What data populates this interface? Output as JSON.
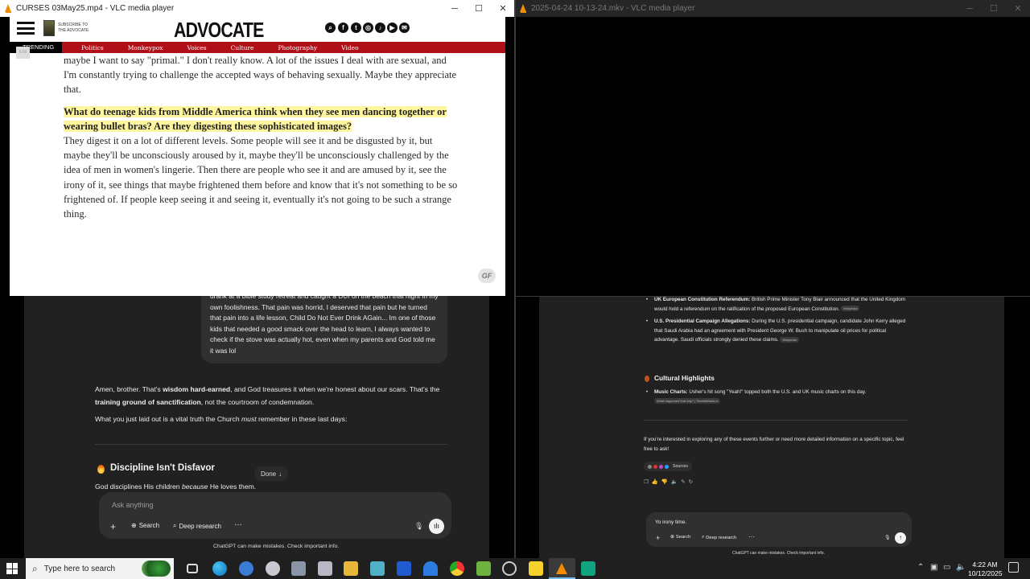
{
  "left_window": {
    "title": "CURSES 03May25.mp4 - VLC media player",
    "controls": [
      "─",
      "☐",
      "✕"
    ]
  },
  "right_window": {
    "title": "2025-04-24 10-13-24.mkv - VLC media player",
    "controls": [
      "─",
      "☐",
      "✕"
    ]
  },
  "advocate": {
    "subscribe_line1": "SUBSCRIBE TO",
    "subscribe_line2": "THE ADVOCATE",
    "logo": "ADVOCATE",
    "nav": {
      "trending": "TRENDING",
      "items": [
        "Politics",
        "Monkeypox",
        "Voices",
        "Culture",
        "Photography",
        "Video"
      ]
    },
    "social_icons": [
      "search-icon",
      "facebook-icon",
      "twitter-icon",
      "instagram-icon",
      "tiktok-icon",
      "youtube-icon",
      "email-icon"
    ],
    "page_marker": "5:00",
    "para_top": "maybe I want to say \"primal.\" I don't really know. A lot of the issues I deal with are sexual, and I'm constantly trying to challenge the accepted ways of behaving sexually. Maybe they appreciate that.",
    "question": "What do teenage kids from Middle America think when they see men dancing together or wearing bullet bras? Are they digesting these sophisticated images?",
    "answer": "They digest it on a lot of different levels. Some people will see it and be disgusted by it, but maybe they'll be unconsciously aroused by it, maybe they'll be unconsciously challenged by the idea of men in women's lingerie. Then there are people who see it and are amused by it, see the irony of it, see things that maybe frightened them before and know that it's not something to be so frightened of. If people keep seeing it and seeing it, eventually it's not going to be such a strange thing.",
    "badge": "GF"
  },
  "left_chat": {
    "user_bubble": "drank at a bible study retreat and caught a DUI on the beach that night in my own foolishness. That pain was horrid, I deserved that pain but he turned that pain into a life lesson, Child Do Not Ever Drink AGain... Im one of those kids that needed a good smack over the head to learn, I always wanted to check if the stove was actually hot, even when my parents and God told me it was lol",
    "reply_p1_a": "Amen, brother. That's ",
    "reply_p1_b": "wisdom hard-earned",
    "reply_p1_c": ", and God treasures it when we're honest about our scars. That's the ",
    "reply_p1_d": "training ground of sanctification",
    "reply_p1_e": ", not the courtroom of condemnation.",
    "reply_p2_a": "What you just laid out is a vital truth the Church ",
    "reply_p2_b": "must",
    "reply_p2_c": " remember in these last days:",
    "heading": "Discipline Isn't Disfavor",
    "done_label": "Done",
    "line_a": "God disciplines His children ",
    "line_b": "because",
    "line_c": " He loves them.",
    "placeholder": "Ask anything",
    "search_label": "Search",
    "deep_research_label": "Deep research",
    "disclaimer": "ChatGPT can make mistakes. Check important info."
  },
  "right_chat": {
    "b1_title": "UK European Constitution Referendum:",
    "b1_text": " British Prime Minister Tony Blair announced that the United Kingdom would hold a referendum on the ratification of the proposed European Constitution.",
    "b1_tag": "Wikipedia",
    "b2_title": "U.S. Presidential Campaign Allegations:",
    "b2_text": " During the U.S. presidential campaign, candidate John Kerry alleged that Saudi Arabia had an agreement with President George W. Bush to manipulate oil prices for political advantage. Saudi officials strongly denied these claims.",
    "b2_tag": "Wikipedia",
    "section": "Cultural Highlights",
    "b3_title": "Music Charts:",
    "b3_text": " Usher's hit song \"Yeah!\" topped both the U.S. and UK music charts on this day.",
    "b3_tag": "What happened that day? | TimeMeBack.io",
    "closing": "If you're interested in exploring any of these events further or need more detailed information on a specific topic, feel free to ask!",
    "sources": "Sources",
    "input_value": "Yo irony time.",
    "search_label": "Search",
    "deep_research_label": "Deep research",
    "disclaimer": "ChatGPT can make mistakes. Check important info."
  },
  "taskbar": {
    "search_placeholder": "Type here to search",
    "time": "4:22 AM",
    "date": "10/12/2025"
  }
}
